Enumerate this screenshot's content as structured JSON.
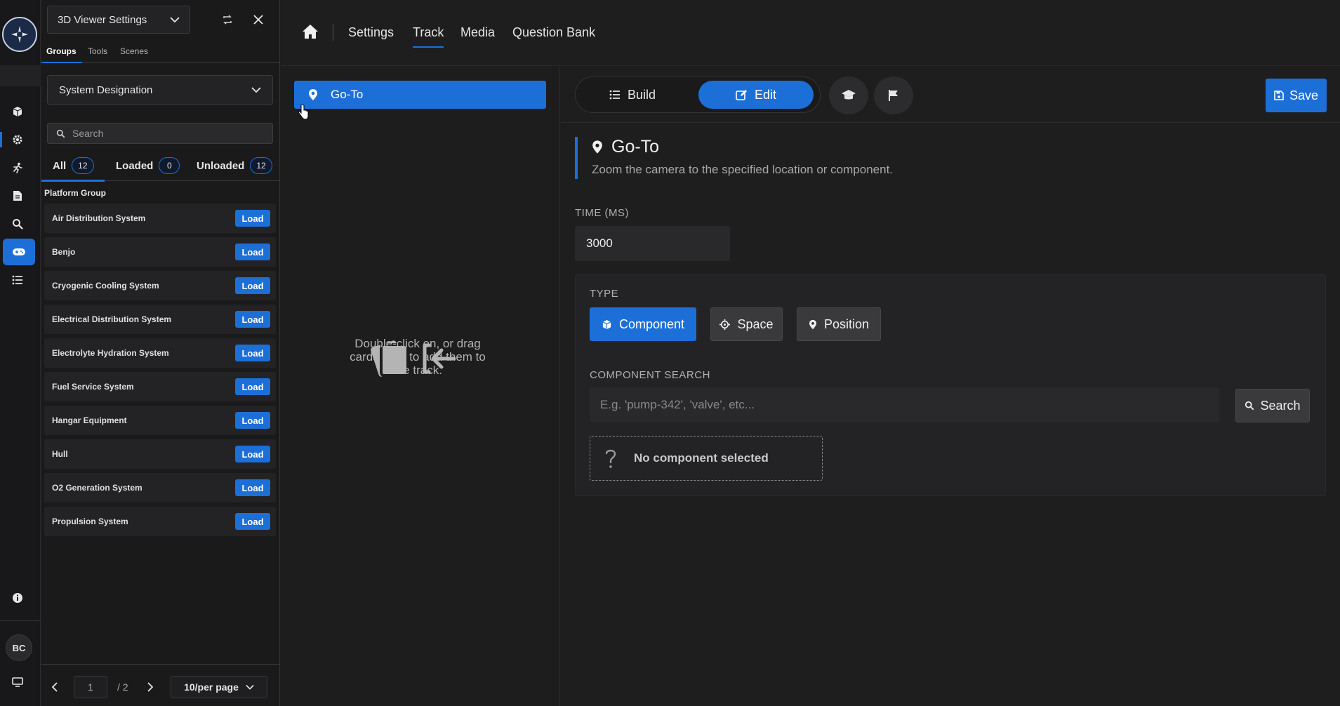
{
  "panel": {
    "viewer_title": "3D Viewer Settings",
    "tabs": [
      "Groups",
      "Tools",
      "Scenes"
    ],
    "system_dropdown": "System Designation",
    "search_placeholder": "Search",
    "filters": [
      {
        "label": "All",
        "count": "12"
      },
      {
        "label": "Loaded",
        "count": "0"
      },
      {
        "label": "Unloaded",
        "count": "12"
      }
    ],
    "group_header": "Platform Group",
    "load_label": "Load",
    "items": [
      "Air Distribution System",
      "Benjo",
      "Cryogenic Cooling System",
      "Electrical Distribution System",
      "Electrolyte Hydration System",
      "Fuel Service System",
      "Hangar Equipment",
      "Hull",
      "O2 Generation System",
      "Propulsion System"
    ],
    "pager": {
      "page": "1",
      "total": "/ 2",
      "per_page": "10/per page"
    }
  },
  "rail": {
    "avatar": "BC"
  },
  "nav": {
    "links": [
      "Settings",
      "Track",
      "Media",
      "Question Bank"
    ],
    "active": "Track"
  },
  "track": {
    "card_label": "Go-To",
    "drop_hint": "Double-click on, or drag cards here to add them to the track."
  },
  "editor": {
    "build_label": "Build",
    "edit_label": "Edit",
    "save_label": "Save",
    "title": "Go-To",
    "description": "Zoom the camera to the specified location or component.",
    "time_label": "TIME (MS)",
    "time_value": "3000",
    "type_label": "TYPE",
    "types": [
      "Component",
      "Space",
      "Position"
    ],
    "active_type": "Component",
    "component_search_label": "COMPONENT SEARCH",
    "component_search_placeholder": "E.g. 'pump-342', 'valve', etc...",
    "search_button": "Search",
    "no_component": "No component selected"
  },
  "colors": {
    "accent": "#1d6fd8",
    "background": "#1e1e1f",
    "panel": "#1a1a1b"
  }
}
